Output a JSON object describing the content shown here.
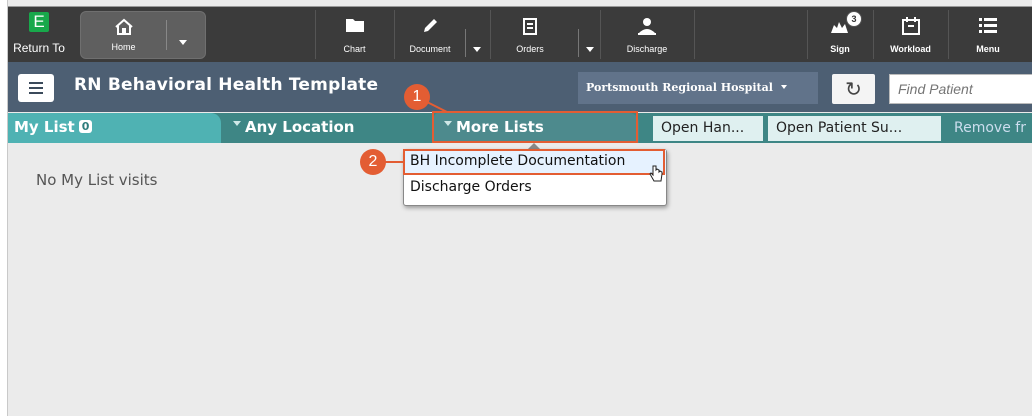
{
  "toolbar": {
    "return_label": "Return To",
    "return_logo": "E",
    "home_label": "Home",
    "chart_label": "Chart",
    "document_label": "Document",
    "orders_label": "Orders",
    "discharge_label": "Discharge",
    "sign_label": "Sign",
    "sign_badge": "3",
    "workload_label": "Workload",
    "menu_label": "Menu"
  },
  "header": {
    "title": "RN Behavioral Health Template",
    "hospital": "Portsmouth Regional Hospital",
    "find_patient_placeholder": "Find Patient"
  },
  "tabs": {
    "my_list_label": "My List",
    "my_list_count": "0",
    "any_location_label": "Any Location",
    "more_lists_label": "More Lists",
    "actions": [
      "Open Han...",
      "Open Patient Su...",
      "Remove fr"
    ]
  },
  "content": {
    "empty_message": "No My List visits"
  },
  "dropdown": {
    "items": [
      "BH Incomplete Documentation",
      "Discharge Orders"
    ]
  },
  "callouts": [
    "1",
    "2"
  ],
  "colors": {
    "accent_orange": "#e35d33",
    "teal_tab": "#4fb2b3",
    "header_slate": "#4d5f73"
  }
}
